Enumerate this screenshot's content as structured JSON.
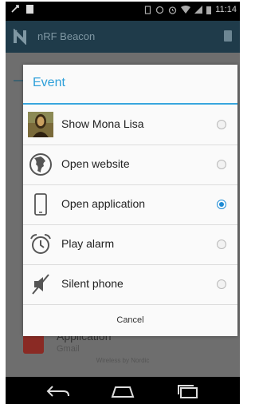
{
  "status_bar": {
    "time": "11:14"
  },
  "app_bar": {
    "title": "nRF Beacon"
  },
  "background": {
    "item_title": "Application",
    "item_sub": "Gmail",
    "footer": "Wireless by Nordic"
  },
  "dialog": {
    "title": "Event",
    "options": [
      {
        "label": "Show Mona Lisa",
        "icon": "mona-lisa-thumbnail",
        "checked": false
      },
      {
        "label": "Open website",
        "icon": "globe-icon",
        "checked": false
      },
      {
        "label": "Open application",
        "icon": "phone-icon",
        "checked": true
      },
      {
        "label": "Play alarm",
        "icon": "alarm-clock-icon",
        "checked": false
      },
      {
        "label": "Silent phone",
        "icon": "silent-icon",
        "checked": false
      }
    ],
    "cancel_label": "Cancel"
  },
  "nav_bar": {
    "buttons": [
      "back-icon",
      "home-icon",
      "recents-icon"
    ]
  }
}
